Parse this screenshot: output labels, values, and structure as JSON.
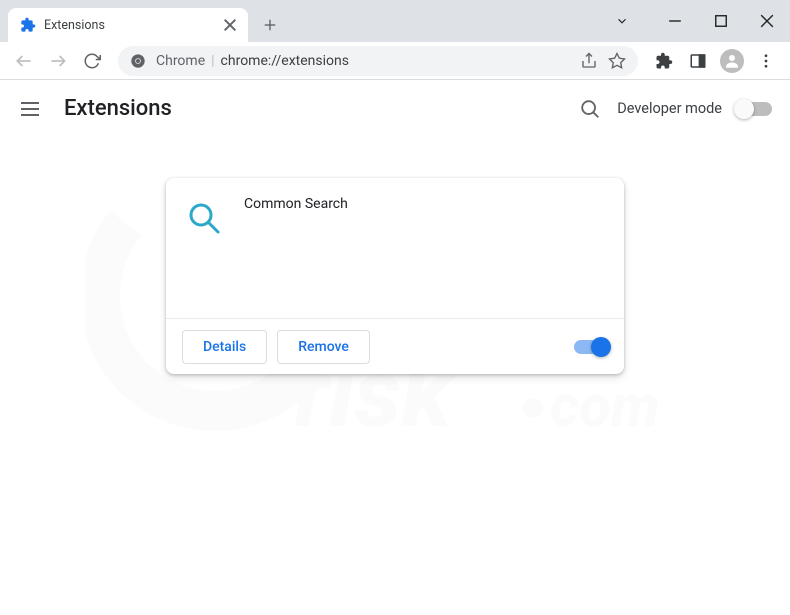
{
  "tab": {
    "title": "Extensions"
  },
  "omnibox": {
    "prefix": "Chrome",
    "url": "chrome://extensions"
  },
  "page": {
    "title": "Extensions",
    "dev_mode_label": "Developer mode"
  },
  "extension": {
    "name": "Common Search",
    "details_label": "Details",
    "remove_label": "Remove",
    "enabled": true
  },
  "icons": {
    "search": "search-icon",
    "menu": "menu-icon"
  }
}
